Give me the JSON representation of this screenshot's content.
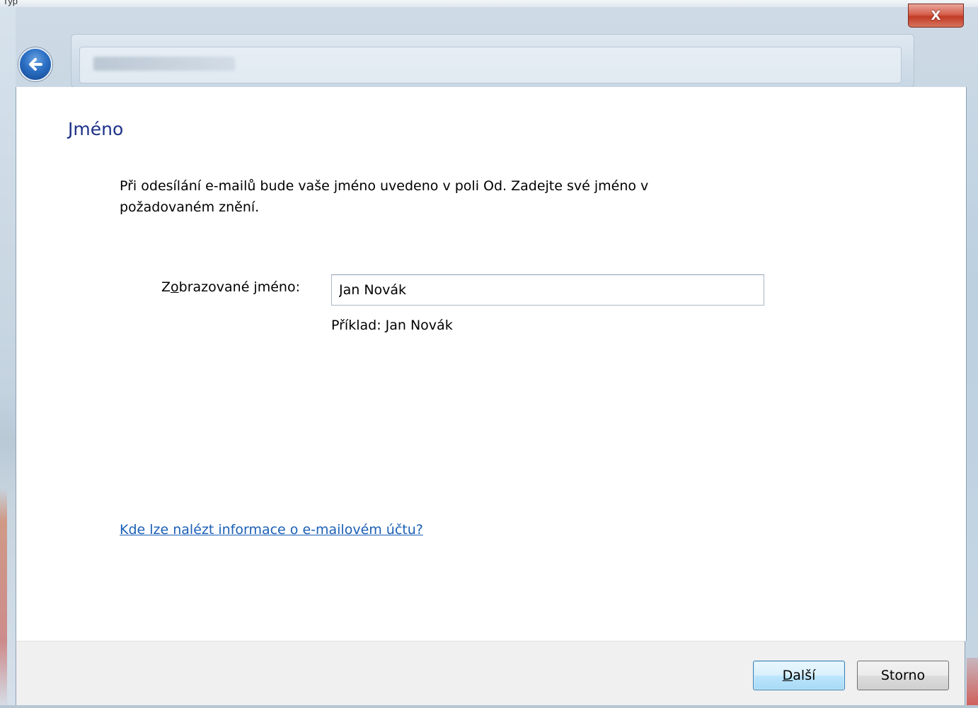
{
  "window": {
    "close_label": "X",
    "caption_fragment": "Typ"
  },
  "page": {
    "heading": "Jméno",
    "description": "Při odesílání e-mailů bude vaše jméno uvedeno v poli Od. Zadejte své jméno v požadovaném znění.",
    "display_name_label_pre": "Z",
    "display_name_label_access": "o",
    "display_name_label_post": "brazované jméno:",
    "display_name_value": "Jan Novák",
    "example_text": "Příklad: Jan Novák",
    "help_link": "Kde lze nalézt informace o e-mailovém účtu?"
  },
  "footer": {
    "next_access": "D",
    "next_rest": "alší",
    "cancel_label": "Storno"
  },
  "icons": {
    "back": "back-arrow-icon",
    "close": "close-icon"
  },
  "colors": {
    "heading": "#1e3287",
    "link": "#1b5fb5",
    "close_button": "#c23b25",
    "footer_bg": "#f0f0f0"
  }
}
